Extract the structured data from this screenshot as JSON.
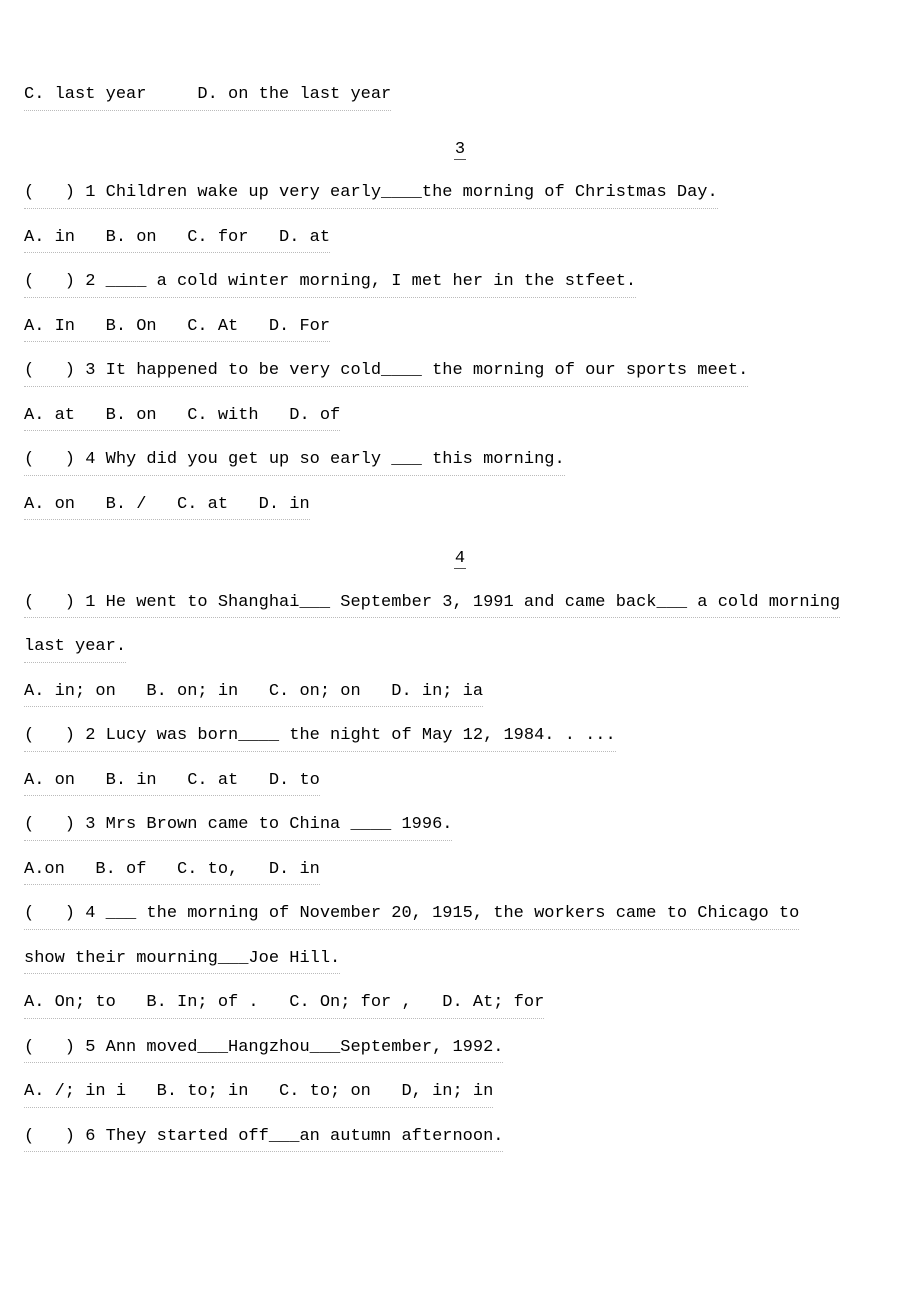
{
  "topline": "C. last year     D. on the last year",
  "sec3": {
    "num": "3",
    "q1": "(   ) 1 Children wake up very early____the morning of Christmas Day.",
    "a1": "A. in   B. on   C. for   D. at",
    "q2": "(   ) 2 ____ a cold winter morning, I met her in the stfeet.",
    "a2": "A. In   B. On   C. At   D. For",
    "q3": "(   ) 3 It happened to be very cold____ the morning of our sports meet.",
    "a3": "A. at   B. on   C. with   D. of",
    "q4": "(   ) 4 Why did you get up so early ___ this morning.",
    "a4": "A. on   B. /   C. at   D. in"
  },
  "sec4": {
    "num": "4",
    "q1": "(   ) 1 He went to Shanghai___ September 3, 1991 and came back___ a cold morning",
    "q1b": "last year.",
    "a1": "A. in; on   B. on; in   C. on; on   D. in; ia",
    "q2": "(   ) 2 Lucy was born____ the night of May 12, 1984. . ...",
    "a2": "A. on   B. in   C. at   D. to",
    "q3": "(   ) 3 Mrs Brown came to China ____ 1996.",
    "a3": "A.on   B. of   C. to,   D. in",
    "q4": "(   ) 4 ___ the morning of November 20, 1915, the workers came to Chicago to",
    "q4b": "show their mourning___Joe Hill.",
    "a4": "A. On; to   B. In; of .   C. On; for ,   D. At; for",
    "q5": "(   ) 5 Ann moved___Hangzhou___September, 1992.",
    "a5": "A. /; in i   B. to; in   C. to; on   D, in; in",
    "q6": "(   ) 6 They started off___an autumn afternoon."
  }
}
